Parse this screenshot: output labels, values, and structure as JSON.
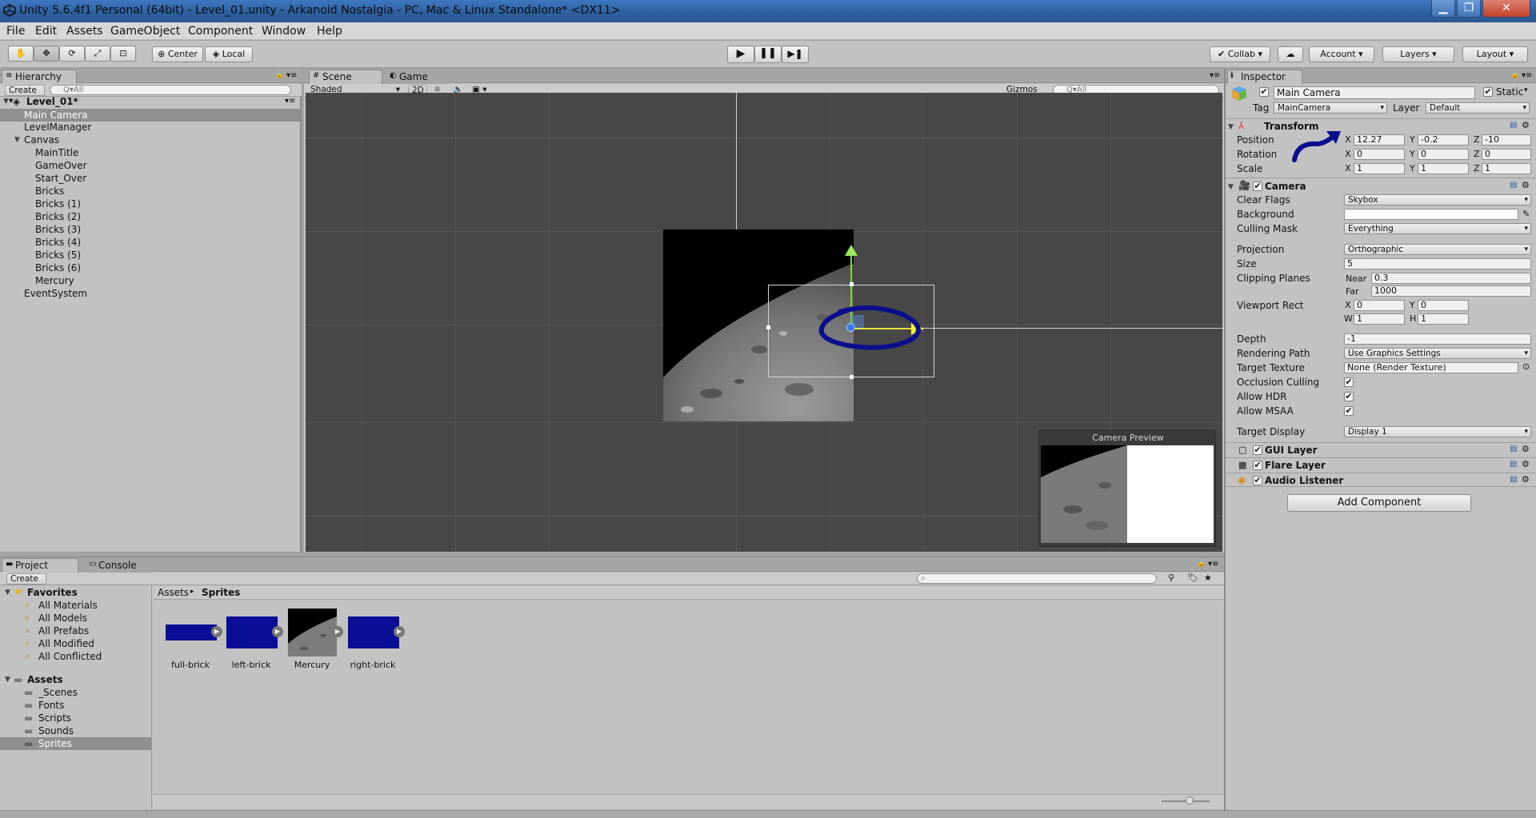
{
  "window": {
    "title": "Unity 5.6.4f1 Personal (64bit) - Level_01.unity - Arkanoid Nostalgia - PC, Mac & Linux Standalone* <DX11>"
  },
  "menu": [
    "File",
    "Edit",
    "Assets",
    "GameObject",
    "Component",
    "Window",
    "Help"
  ],
  "toolbar": {
    "pivot": "Center",
    "space": "Local",
    "collab": "Collab",
    "account": "Account",
    "layers": "Layers",
    "layout": "Layout"
  },
  "hierarchy": {
    "tab": "Hierarchy",
    "create": "Create",
    "search_placeholder": "Q▾All",
    "scene_name": "Level_01*",
    "items": [
      "Main Camera",
      "LevelManager",
      "Canvas",
      "MainTitle",
      "GameOver",
      "Start_Over",
      "Bricks",
      "Bricks (1)",
      "Bricks (2)",
      "Bricks (3)",
      "Bricks (4)",
      "Bricks (5)",
      "Bricks (6)",
      "Mercury",
      "EventSystem"
    ]
  },
  "scene": {
    "tab_scene": "Scene",
    "tab_game": "Game",
    "shading": "Shaded",
    "mode_2d": "2D",
    "gizmos": "Gizmos",
    "search_placeholder": "Q▾All",
    "camera_preview": "Camera Preview"
  },
  "project": {
    "tab_project": "Project",
    "tab_console": "Console",
    "create": "Create",
    "favorites_label": "Favorites",
    "favorites": [
      "All Materials",
      "All Models",
      "All Prefabs",
      "All Modified",
      "All Conflicted"
    ],
    "assets_label": "Assets",
    "folders": [
      "_Scenes",
      "Fonts",
      "Scripts",
      "Sounds",
      "Sprites"
    ],
    "breadcrumb": [
      "Assets",
      "Sprites"
    ],
    "files": [
      "full-brick",
      "left-brick",
      "Mercury",
      "right-brick"
    ],
    "colors": {
      "brick": "#0a0d96"
    }
  },
  "inspector": {
    "tab": "Inspector",
    "object_name": "Main Camera",
    "static_label": "Static",
    "tag_label": "Tag",
    "tag_value": "MainCamera",
    "layer_label": "Layer",
    "layer_value": "Default",
    "transform": {
      "title": "Transform",
      "position_label": "Position",
      "rotation_label": "Rotation",
      "scale_label": "Scale",
      "position": [
        "12.27",
        "-0.2",
        "-10"
      ],
      "rotation": [
        "0",
        "0",
        "0"
      ],
      "scale": [
        "1",
        "1",
        "1"
      ],
      "axes": [
        "X",
        "Y",
        "Z"
      ]
    },
    "camera": {
      "title": "Camera",
      "clear_flags_label": "Clear Flags",
      "clear_flags": "Skybox",
      "background_label": "Background",
      "culling_mask_label": "Culling Mask",
      "culling_mask": "Everything",
      "projection_label": "Projection",
      "projection": "Orthographic",
      "size_label": "Size",
      "size": "5",
      "clipping_label": "Clipping Planes",
      "near_label": "Near",
      "near": "0.3",
      "far_label": "Far",
      "far": "1000",
      "viewport_label": "Viewport Rect",
      "vx": "0",
      "vy": "0",
      "vw": "1",
      "vh": "1",
      "x_label": "X",
      "y_label": "Y",
      "w_label": "W",
      "h_label": "H",
      "depth_label": "Depth",
      "depth": "-1",
      "rendering_path_label": "Rendering Path",
      "rendering_path": "Use Graphics Settings",
      "target_texture_label": "Target Texture",
      "target_texture": "None (Render Texture)",
      "occlusion_label": "Occlusion Culling",
      "hdr_label": "Allow HDR",
      "msaa_label": "Allow MSAA",
      "target_display_label": "Target Display",
      "target_display": "Display 1"
    },
    "components": [
      "GUI Layer",
      "Flare Layer",
      "Audio Listener"
    ],
    "add_component": "Add Component"
  }
}
